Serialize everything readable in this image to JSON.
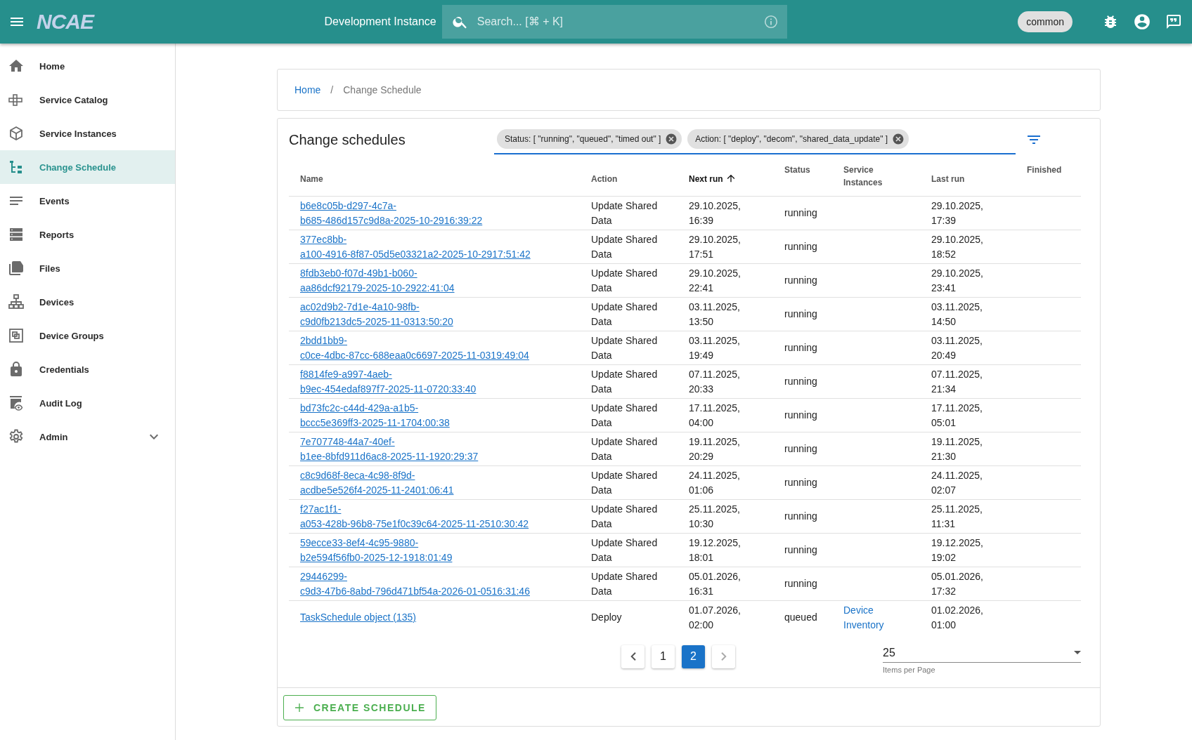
{
  "topbar": {
    "logo": "NCAE",
    "instance": "Development Instance",
    "search": {
      "placeholder": "Search... [⌘ + K]"
    },
    "user_chip": "common"
  },
  "sidebar": {
    "items": [
      {
        "label": "Home",
        "selected": false
      },
      {
        "label": "Service Catalog",
        "selected": false
      },
      {
        "label": "Service Instances",
        "selected": false
      },
      {
        "label": "Change Schedule",
        "selected": true
      },
      {
        "label": "Events",
        "selected": false
      },
      {
        "label": "Reports",
        "selected": false
      },
      {
        "label": "Files",
        "selected": false
      },
      {
        "label": "Devices",
        "selected": false
      },
      {
        "label": "Device Groups",
        "selected": false
      },
      {
        "label": "Credentials",
        "selected": false
      },
      {
        "label": "Audit Log",
        "selected": false
      },
      {
        "label": "Admin",
        "selected": false,
        "expanded": false
      }
    ]
  },
  "breadcrumb": {
    "separator": "/",
    "items": [
      "Home",
      "Change Schedule"
    ]
  },
  "card": {
    "title": "Change schedules",
    "filters": [
      "Status: [ \"running\", \"queued\", \"timed out\" ]",
      "Action: [ \"deploy\", \"decom\", \"shared_data_update\" ]"
    ],
    "table": {
      "columns": [
        {
          "label": "Name",
          "sorted": false
        },
        {
          "label": "Action",
          "sorted": false
        },
        {
          "label": "Next run",
          "sorted": true
        },
        {
          "label": "Status",
          "sorted": false
        },
        {
          "label": "Service Instances",
          "sorted": false
        },
        {
          "label": "Last run",
          "sorted": false
        },
        {
          "label": "Finished",
          "sorted": false
        }
      ],
      "rows": [
        {
          "name": "b6e8c05b-d297-4c7a-b685-486d157c9d8a-2025-10-2916:39:22",
          "action": "Update Shared Data",
          "next_run": "29.10.2025, 16:39",
          "status": "running",
          "last_run": "29.10.2025, 17:39"
        },
        {
          "name": "377ec8bb-a100-4916-8f87-05d5e03321a2-2025-10-2917:51:42",
          "action": "Update Shared Data",
          "next_run": "29.10.2025, 17:51",
          "status": "running",
          "last_run": "29.10.2025, 18:52"
        },
        {
          "name": "8fdb3eb0-f07d-49b1-b060-aa86dcf92179-2025-10-2922:41:04",
          "action": "Update Shared Data",
          "next_run": "29.10.2025, 22:41",
          "status": "running",
          "last_run": "29.10.2025, 23:41"
        },
        {
          "name": "ac02d9b2-7d1e-4a10-98fb-c9d0fb213dc5-2025-11-0313:50:20",
          "action": "Update Shared Data",
          "next_run": "03.11.2025, 13:50",
          "status": "running",
          "last_run": "03.11.2025, 14:50"
        },
        {
          "name": "2bdd1bb9-c0ce-4dbc-87cc-688eaa0c6697-2025-11-0319:49:04",
          "action": "Update Shared Data",
          "next_run": "03.11.2025, 19:49",
          "status": "running",
          "last_run": "03.11.2025, 20:49"
        },
        {
          "name": "f8814fe9-a997-4aeb-b9ec-454edaf897f7-2025-11-0720:33:40",
          "action": "Update Shared Data",
          "next_run": "07.11.2025, 20:33",
          "status": "running",
          "last_run": "07.11.2025, 21:34"
        },
        {
          "name": "bd73fc2c-c44d-429a-a1b5-bccc5e369ff3-2025-11-1704:00:38",
          "action": "Update Shared Data",
          "next_run": "17.11.2025, 04:00",
          "status": "running",
          "last_run": "17.11.2025, 05:01"
        },
        {
          "name": "7e707748-44a7-40ef-b1ee-8bfd911d6ac8-2025-11-1920:29:37",
          "action": "Update Shared Data",
          "next_run": "19.11.2025, 20:29",
          "status": "running",
          "last_run": "19.11.2025, 21:30"
        },
        {
          "name": "c8c9d68f-8eca-4c98-8f9d-acdbe5e526f4-2025-11-2401:06:41",
          "action": "Update Shared Data",
          "next_run": "24.11.2025, 01:06",
          "status": "running",
          "last_run": "24.11.2025, 02:07"
        },
        {
          "name": "f27ac1f1-a053-428b-96b8-75e1f0c39c64-2025-11-2510:30:42",
          "action": "Update Shared Data",
          "next_run": "25.11.2025, 10:30",
          "status": "running",
          "last_run": "25.11.2025, 11:31"
        },
        {
          "name": "59ecce33-8ef4-4c95-9880-b2e594f56fb0-2025-12-1918:01:49",
          "action": "Update Shared Data",
          "next_run": "19.12.2025, 18:01",
          "status": "running",
          "last_run": "19.12.2025, 19:02"
        },
        {
          "name": "29446299-c9d3-47b6-8abd-796d471bf54a-2026-01-0516:31:46",
          "action": "Update Shared Data",
          "next_run": "05.01.2026, 16:31",
          "status": "running",
          "last_run": "05.01.2026, 17:32"
        },
        {
          "name": "TaskSchedule object (135)",
          "action": "Deploy",
          "next_run": "01.07.2026, 02:00",
          "status": "queued",
          "service_instances": "Device Inventory",
          "last_run": "01.02.2026, 01:00"
        }
      ]
    },
    "pagination": {
      "pages": [
        {
          "label": "1",
          "selected": false
        },
        {
          "label": "2",
          "selected": true
        }
      ]
    },
    "items_per_page": {
      "value": "25",
      "label": "Items per Page"
    },
    "create_button": "CREATE SCHEDULE"
  }
}
